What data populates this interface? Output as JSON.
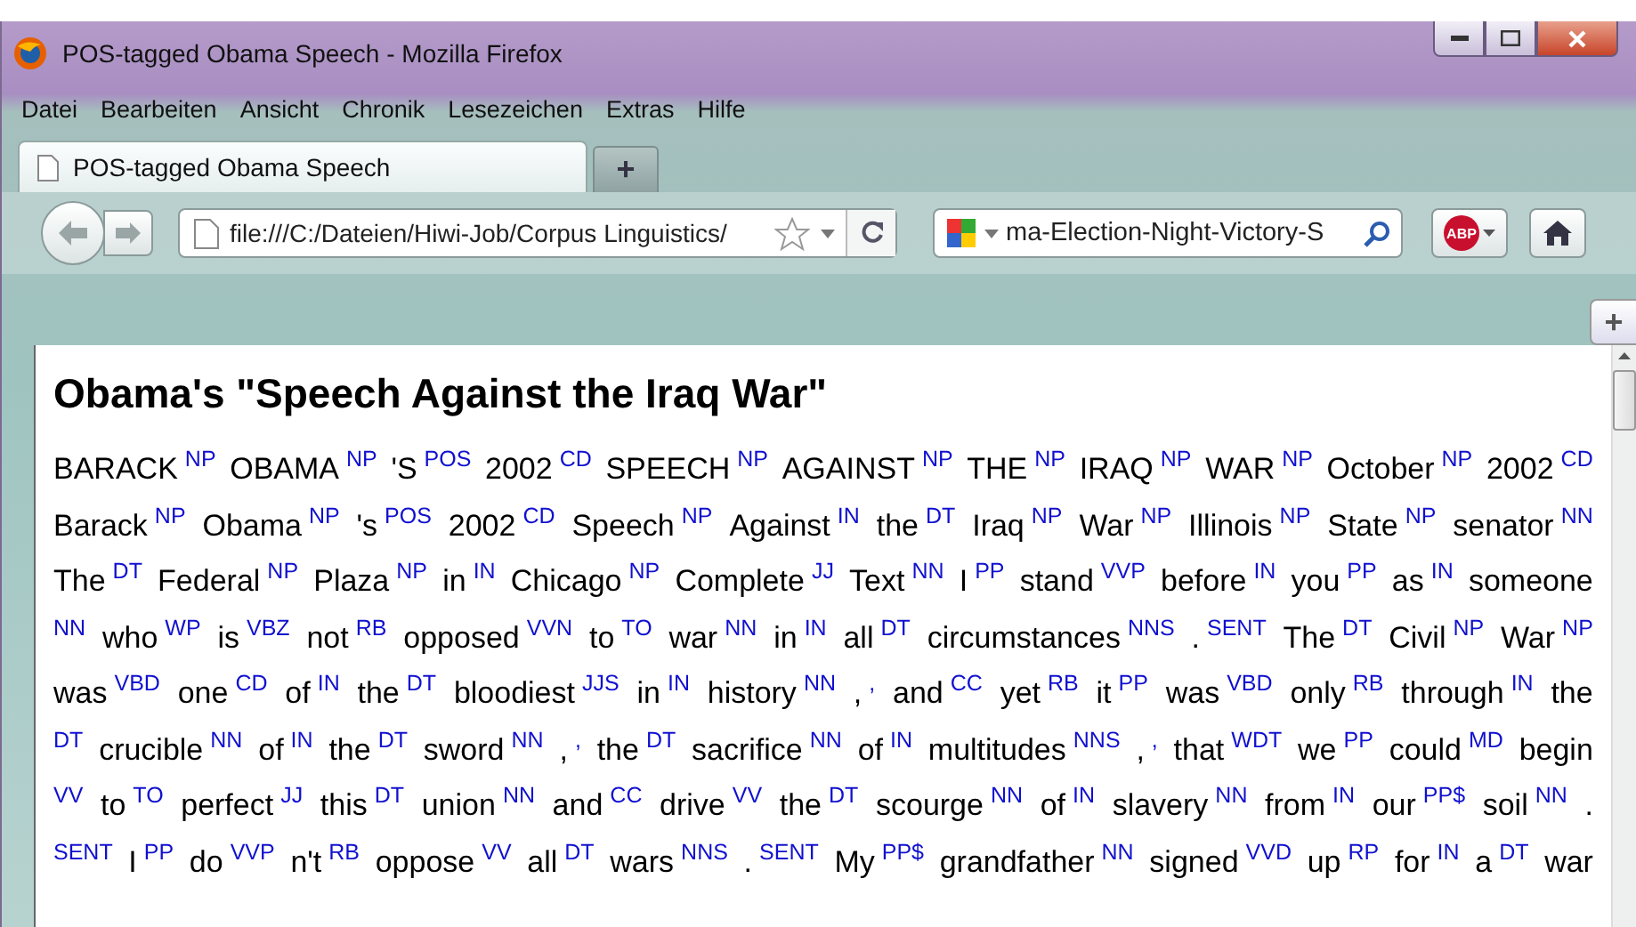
{
  "window": {
    "title": "POS-tagged Obama Speech - Mozilla Firefox"
  },
  "menu": [
    "Datei",
    "Bearbeiten",
    "Ansicht",
    "Chronik",
    "Lesezeichen",
    "Extras",
    "Hilfe"
  ],
  "tabs": [
    {
      "label": "POS-tagged Obama Speech",
      "selected": true
    }
  ],
  "new_tab": "+",
  "address": {
    "value": "file:///C:/Dateien/Hiwi-Job/Corpus Linguistics/"
  },
  "search": {
    "value": "ma-Election-Night-Victory-S"
  },
  "adblock": "ABP",
  "add_toolbar": "+",
  "page": {
    "heading": "Obama's \"Speech Against the Iraq War\"",
    "lines": [
      [
        {
          "word": "BARACK",
          "tag": "NP"
        },
        {
          "word": "OBAMA",
          "tag": "NP"
        },
        {
          "word": "'S",
          "tag": "POS"
        },
        {
          "word": "2002",
          "tag": "CD"
        },
        {
          "word": "SPEECH",
          "tag": "NP"
        },
        {
          "word": "AGAINST",
          "tag": "NP"
        },
        {
          "word": "THE",
          "tag": "NP"
        },
        {
          "word": "IRAQ",
          "tag": "NP"
        },
        {
          "word": "WAR",
          "tag": "NP"
        },
        {
          "word": "October",
          "tag": "NP"
        },
        {
          "word": "2002",
          "tag": "CD"
        }
      ],
      [
        {
          "word": "Barack",
          "tag": "NP"
        },
        {
          "word": "Obama",
          "tag": "NP"
        },
        {
          "word": "'s",
          "tag": "POS"
        },
        {
          "word": "2002",
          "tag": "CD"
        },
        {
          "word": "Speech",
          "tag": "NP"
        },
        {
          "word": "Against",
          "tag": "IN"
        },
        {
          "word": "the",
          "tag": "DT"
        },
        {
          "word": "Iraq",
          "tag": "NP"
        },
        {
          "word": "War",
          "tag": "NP"
        },
        {
          "word": "Illinois",
          "tag": "NP"
        },
        {
          "word": "State",
          "tag": "NP"
        },
        {
          "word": "senator",
          "tag": "NN"
        }
      ],
      [
        {
          "word": "The",
          "tag": "DT"
        },
        {
          "word": "Federal",
          "tag": "NP"
        },
        {
          "word": "Plaza",
          "tag": "NP"
        },
        {
          "word": "in",
          "tag": "IN"
        },
        {
          "word": "Chicago",
          "tag": "NP"
        },
        {
          "word": "Complete",
          "tag": "JJ"
        },
        {
          "word": "Text",
          "tag": "NN"
        },
        {
          "word": "I",
          "tag": "PP"
        },
        {
          "word": "stand",
          "tag": "VVP"
        },
        {
          "word": "before",
          "tag": "IN"
        },
        {
          "word": "you",
          "tag": "PP"
        },
        {
          "word": "as",
          "tag": "IN"
        },
        {
          "word": "someone"
        }
      ],
      [
        {
          "tag": "NN"
        },
        {
          "word": "who",
          "tag": "WP"
        },
        {
          "word": "is",
          "tag": "VBZ"
        },
        {
          "word": "not",
          "tag": "RB"
        },
        {
          "word": "opposed",
          "tag": "VVN"
        },
        {
          "word": "to",
          "tag": "TO"
        },
        {
          "word": "war",
          "tag": "NN"
        },
        {
          "word": "in",
          "tag": "IN"
        },
        {
          "word": "all",
          "tag": "DT"
        },
        {
          "word": "circumstances",
          "tag": "NNS"
        },
        {
          "word": ".",
          "tag": "SENT"
        },
        {
          "word": "The",
          "tag": "DT"
        },
        {
          "word": "Civil",
          "tag": "NP"
        },
        {
          "word": "War",
          "tag": "NP"
        }
      ],
      [
        {
          "word": "was",
          "tag": "VBD"
        },
        {
          "word": "one",
          "tag": "CD"
        },
        {
          "word": "of",
          "tag": "IN"
        },
        {
          "word": "the",
          "tag": "DT"
        },
        {
          "word": "bloodiest",
          "tag": "JJS"
        },
        {
          "word": "in",
          "tag": "IN"
        },
        {
          "word": "history",
          "tag": "NN"
        },
        {
          "word": ",",
          "tag": ","
        },
        {
          "word": "and",
          "tag": "CC"
        },
        {
          "word": "yet",
          "tag": "RB"
        },
        {
          "word": "it",
          "tag": "PP"
        },
        {
          "word": "was",
          "tag": "VBD"
        },
        {
          "word": "only",
          "tag": "RB"
        },
        {
          "word": "through",
          "tag": "IN"
        },
        {
          "word": "the"
        }
      ],
      [
        {
          "tag": "DT"
        },
        {
          "word": "crucible",
          "tag": "NN"
        },
        {
          "word": "of",
          "tag": "IN"
        },
        {
          "word": "the",
          "tag": "DT"
        },
        {
          "word": "sword",
          "tag": "NN"
        },
        {
          "word": ",",
          "tag": ","
        },
        {
          "word": "the",
          "tag": "DT"
        },
        {
          "word": "sacrifice",
          "tag": "NN"
        },
        {
          "word": "of",
          "tag": "IN"
        },
        {
          "word": "multitudes",
          "tag": "NNS"
        },
        {
          "word": ",",
          "tag": ","
        },
        {
          "word": "that",
          "tag": "WDT"
        },
        {
          "word": "we",
          "tag": "PP"
        },
        {
          "word": "could",
          "tag": "MD"
        },
        {
          "word": "begin"
        }
      ],
      [
        {
          "tag": "VV"
        },
        {
          "word": "to",
          "tag": "TO"
        },
        {
          "word": "perfect",
          "tag": "JJ"
        },
        {
          "word": "this",
          "tag": "DT"
        },
        {
          "word": "union",
          "tag": "NN"
        },
        {
          "word": "and",
          "tag": "CC"
        },
        {
          "word": "drive",
          "tag": "VV"
        },
        {
          "word": "the",
          "tag": "DT"
        },
        {
          "word": "scourge",
          "tag": "NN"
        },
        {
          "word": "of",
          "tag": "IN"
        },
        {
          "word": "slavery",
          "tag": "NN"
        },
        {
          "word": "from",
          "tag": "IN"
        },
        {
          "word": "our",
          "tag": "PP$"
        },
        {
          "word": "soil",
          "tag": "NN"
        },
        {
          "word": "."
        }
      ],
      [
        {
          "tag": "SENT"
        },
        {
          "word": "I",
          "tag": "PP"
        },
        {
          "word": "do",
          "tag": "VVP"
        },
        {
          "word": "n't",
          "tag": "RB"
        },
        {
          "word": "oppose",
          "tag": "VV"
        },
        {
          "word": "all",
          "tag": "DT"
        },
        {
          "word": "wars",
          "tag": "NNS"
        },
        {
          "word": ".",
          "tag": "SENT"
        },
        {
          "word": "My",
          "tag": "PP$"
        },
        {
          "word": "grandfather",
          "tag": "NN"
        },
        {
          "word": "signed",
          "tag": "VVD"
        },
        {
          "word": "up",
          "tag": "RP"
        },
        {
          "word": "for",
          "tag": "IN"
        },
        {
          "word": "a",
          "tag": "DT"
        },
        {
          "word": "war"
        }
      ]
    ]
  }
}
